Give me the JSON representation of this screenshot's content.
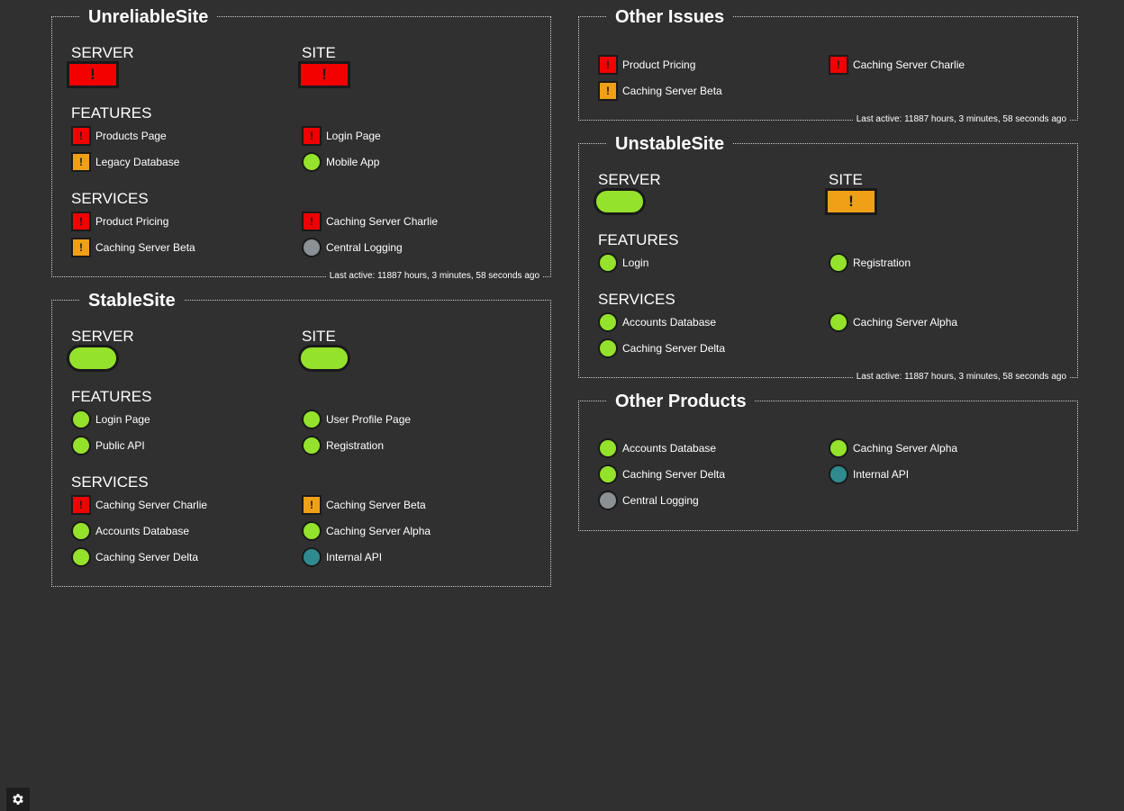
{
  "status_colors": {
    "ok": "#94e22b",
    "error": "#f20000",
    "warning": "#f0a017",
    "unknown": "#8a9093",
    "info": "#2f8a8e"
  },
  "unreliable": {
    "title": "UnreliableSite",
    "server_label": "SERVER",
    "server_status": "error",
    "server_glyph": "!",
    "site_label": "SITE",
    "site_status": "error",
    "site_glyph": "!",
    "features_label": "FEATURES",
    "features": [
      {
        "name": "Products Page",
        "status": "error",
        "glyph": "!"
      },
      {
        "name": "Login Page",
        "status": "error",
        "glyph": "!"
      },
      {
        "name": "Legacy Database",
        "status": "warning",
        "glyph": "!"
      },
      {
        "name": "Mobile App",
        "status": "ok",
        "glyph": ""
      }
    ],
    "services_label": "SERVICES",
    "services": [
      {
        "name": "Product Pricing",
        "status": "error",
        "glyph": "!"
      },
      {
        "name": "Caching Server Charlie",
        "status": "error",
        "glyph": "!"
      },
      {
        "name": "Caching Server Beta",
        "status": "warning",
        "glyph": "!"
      },
      {
        "name": "Central Logging",
        "status": "unknown",
        "glyph": ""
      }
    ],
    "last_active": "Last active: 11887 hours, 3 minutes, 58 seconds ago"
  },
  "stable": {
    "title": "StableSite",
    "server_label": "SERVER",
    "server_status": "ok",
    "site_label": "SITE",
    "site_status": "ok",
    "features_label": "FEATURES",
    "features": [
      {
        "name": "Login Page",
        "status": "ok",
        "glyph": ""
      },
      {
        "name": "User Profile Page",
        "status": "ok",
        "glyph": ""
      },
      {
        "name": "Public API",
        "status": "ok",
        "glyph": ""
      },
      {
        "name": "Registration",
        "status": "ok",
        "glyph": ""
      }
    ],
    "services_label": "SERVICES",
    "services": [
      {
        "name": "Caching Server Charlie",
        "status": "error",
        "glyph": "!"
      },
      {
        "name": "Caching Server Beta",
        "status": "warning",
        "glyph": "!"
      },
      {
        "name": "Accounts Database",
        "status": "ok",
        "glyph": ""
      },
      {
        "name": "Caching Server Alpha",
        "status": "ok",
        "glyph": ""
      },
      {
        "name": "Caching Server Delta",
        "status": "ok",
        "glyph": ""
      },
      {
        "name": "Internal API",
        "status": "info",
        "glyph": ""
      }
    ]
  },
  "other_issues": {
    "title": "Other Issues",
    "items": [
      {
        "name": "Product Pricing",
        "status": "error",
        "glyph": "!"
      },
      {
        "name": "Caching Server Charlie",
        "status": "error",
        "glyph": "!"
      },
      {
        "name": "Caching Server Beta",
        "status": "warning",
        "glyph": "!"
      }
    ],
    "last_active": "Last active: 11887 hours, 3 minutes, 58 seconds ago"
  },
  "unstable": {
    "title": "UnstableSite",
    "server_label": "SERVER",
    "server_status": "ok",
    "site_label": "SITE",
    "site_status": "warning",
    "site_glyph": "!",
    "features_label": "FEATURES",
    "features": [
      {
        "name": "Login",
        "status": "ok",
        "glyph": ""
      },
      {
        "name": "Registration",
        "status": "ok",
        "glyph": ""
      }
    ],
    "services_label": "SERVICES",
    "services": [
      {
        "name": "Accounts Database",
        "status": "ok",
        "glyph": ""
      },
      {
        "name": "Caching Server Alpha",
        "status": "ok",
        "glyph": ""
      },
      {
        "name": "Caching Server Delta",
        "status": "ok",
        "glyph": ""
      }
    ],
    "last_active": "Last active: 11887 hours, 3 minutes, 58 seconds ago"
  },
  "other_products": {
    "title": "Other Products",
    "items": [
      {
        "name": "Accounts Database",
        "status": "ok",
        "glyph": ""
      },
      {
        "name": "Caching Server Alpha",
        "status": "ok",
        "glyph": ""
      },
      {
        "name": "Caching Server Delta",
        "status": "ok",
        "glyph": ""
      },
      {
        "name": "Internal API",
        "status": "info",
        "glyph": ""
      },
      {
        "name": "Central Logging",
        "status": "unknown",
        "glyph": ""
      }
    ]
  },
  "settings": {
    "icon": "gear-icon"
  }
}
